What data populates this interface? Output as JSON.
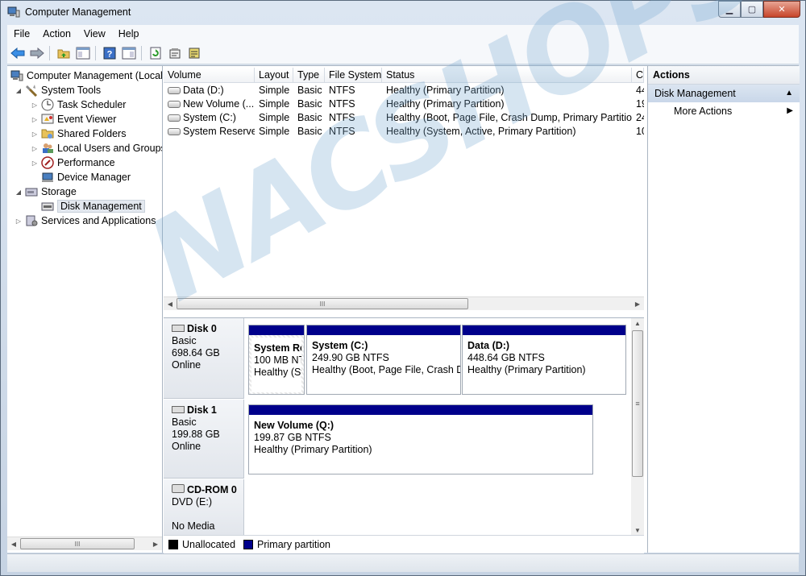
{
  "window": {
    "title": "Computer Management",
    "min": "▁",
    "max": "▢",
    "close": "✕"
  },
  "menu": [
    "File",
    "Action",
    "View",
    "Help"
  ],
  "tree": {
    "root": "Computer Management (Local",
    "system_tools": "System Tools",
    "task_scheduler": "Task Scheduler",
    "event_viewer": "Event Viewer",
    "shared_folders": "Shared Folders",
    "local_users": "Local Users and Groups",
    "performance": "Performance",
    "device_manager": "Device Manager",
    "storage": "Storage",
    "disk_management": "Disk Management",
    "services": "Services and Applications"
  },
  "volume_table": {
    "columns": [
      "Volume",
      "Layout",
      "Type",
      "File System",
      "Status",
      "C"
    ],
    "rows": [
      [
        "Data (D:)",
        "Simple",
        "Basic",
        "NTFS",
        "Healthy (Primary Partition)",
        "44"
      ],
      [
        "New Volume (...",
        "Simple",
        "Basic",
        "NTFS",
        "Healthy (Primary Partition)",
        "19"
      ],
      [
        "System (C:)",
        "Simple",
        "Basic",
        "NTFS",
        "Healthy (Boot, Page File, Crash Dump, Primary Partition)",
        "24"
      ],
      [
        "System Reserved",
        "Simple",
        "Basic",
        "NTFS",
        "Healthy (System, Active, Primary Partition)",
        "10"
      ]
    ]
  },
  "disks": [
    {
      "name": "Disk 0",
      "type": "Basic",
      "size": "698.64 GB",
      "state": "Online",
      "partitions": [
        {
          "name": "System Re",
          "size": "100 MB NT",
          "status": "Healthy (Sy"
        },
        {
          "name": "System  (C:)",
          "size": "249.90 GB NTFS",
          "status": "Healthy (Boot, Page File, Crash Du"
        },
        {
          "name": "Data  (D:)",
          "size": "448.64 GB NTFS",
          "status": "Healthy (Primary Partition)"
        }
      ]
    },
    {
      "name": "Disk 1",
      "type": "Basic",
      "size": "199.88 GB",
      "state": "Online",
      "partitions": [
        {
          "name": "New Volume  (Q:)",
          "size": "199.87 GB NTFS",
          "status": "Healthy (Primary Partition)"
        }
      ]
    },
    {
      "name": "CD-ROM 0",
      "type": "DVD (E:)",
      "state": "No Media"
    }
  ],
  "legend": {
    "unallocated": "Unallocated",
    "primary": "Primary partition",
    "unallocated_color": "#000000",
    "primary_color": "#00008b"
  },
  "actions": {
    "header": "Actions",
    "section": "Disk Management",
    "more": "More Actions"
  },
  "scroll": {
    "grip": "III",
    "grip_v": "≡"
  },
  "watermark": "NACSHOPS.net"
}
